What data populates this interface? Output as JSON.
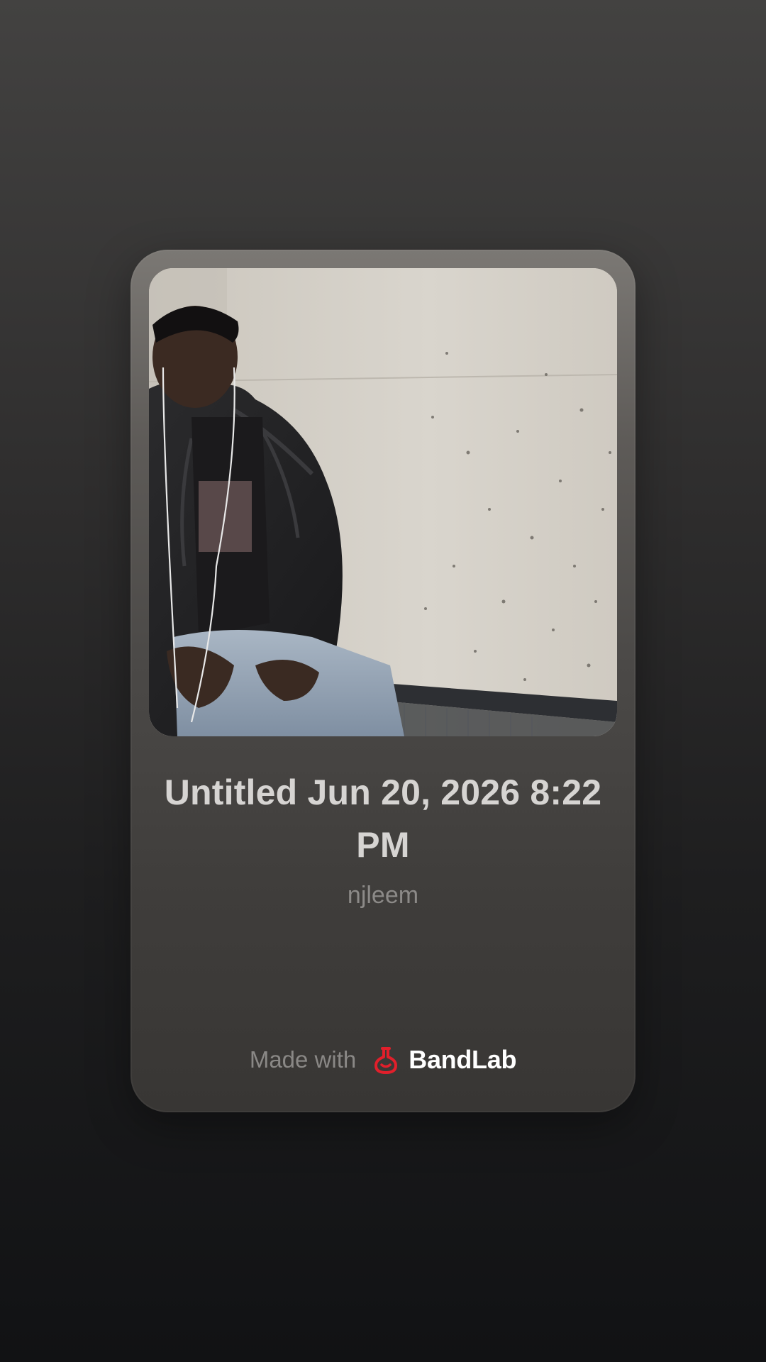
{
  "share_card": {
    "cover_image": "photo of a person in a black puffer jacket wearing earphones, seated against a concrete wall",
    "title": "Untitled Jun 20, 2026 8:22 PM",
    "artist": "njleem",
    "footer": {
      "made_with_label": "Made with",
      "brand_logo_icon": "bandlab-logo-icon",
      "brand_name": "BandLab",
      "brand_color": "#e11f2b"
    }
  },
  "colors": {
    "background_top": "#434241",
    "background_bottom": "#111214",
    "title_text": "#d6d4d2",
    "artist_text": "#8c8a88"
  }
}
